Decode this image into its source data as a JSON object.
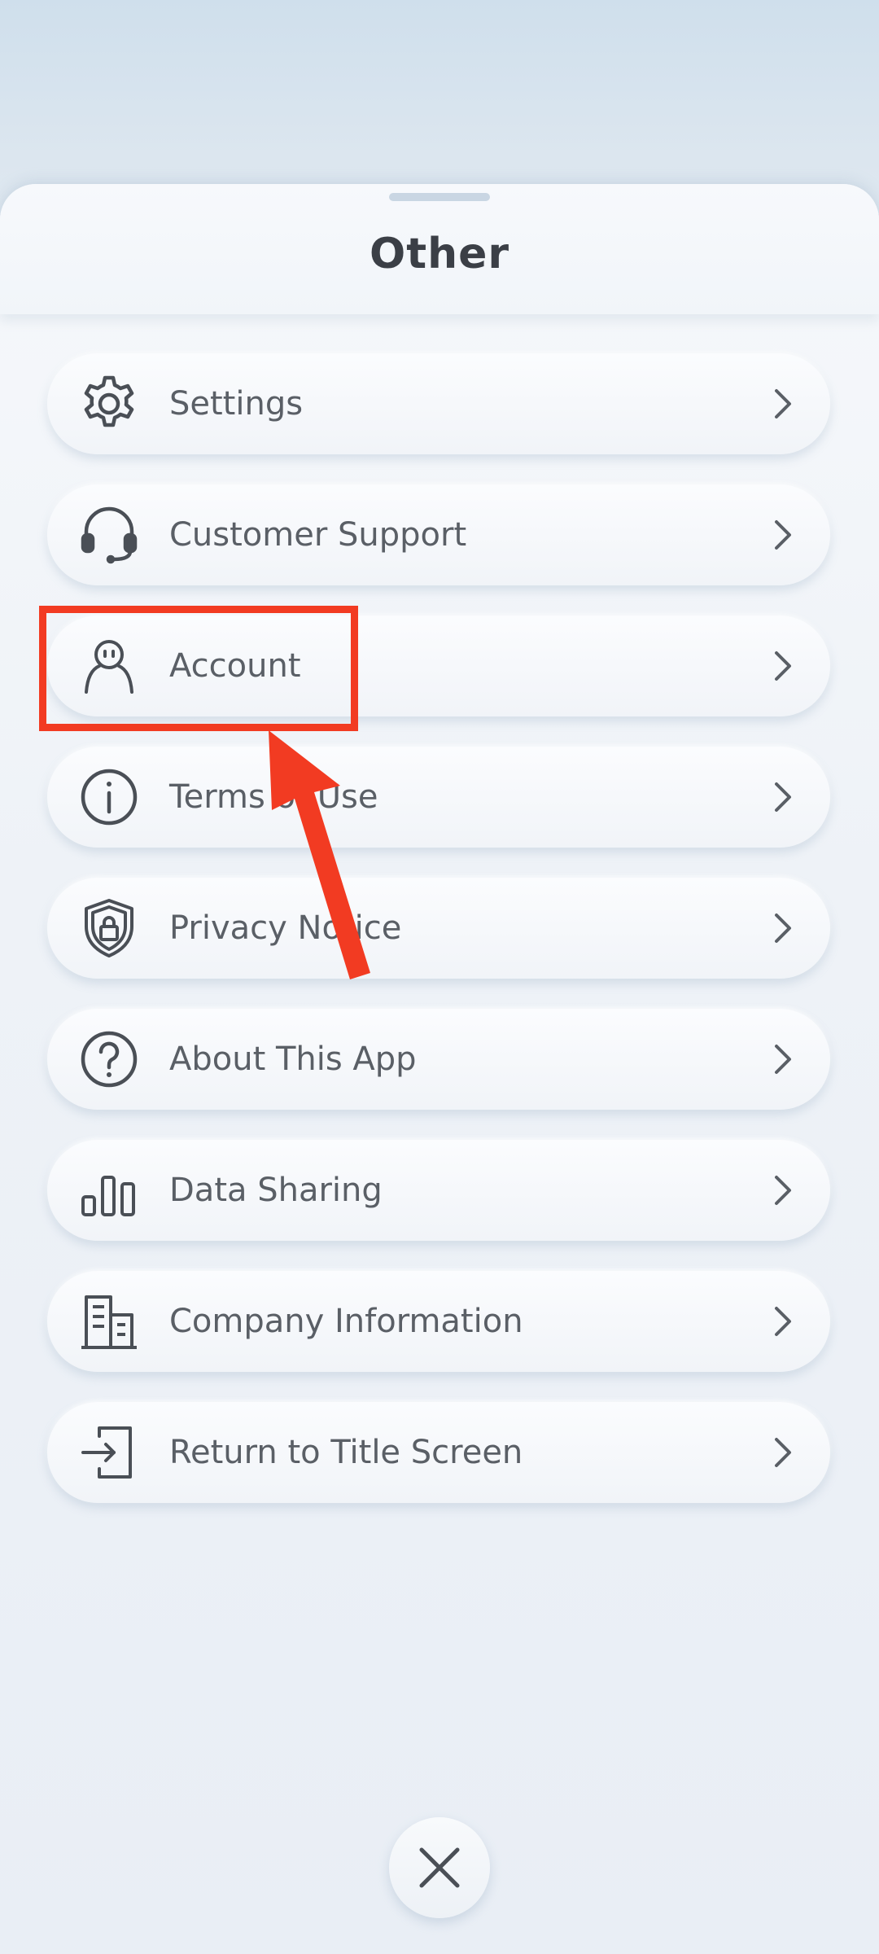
{
  "header": {
    "title": "Other"
  },
  "menu": {
    "items": [
      {
        "label": "Settings",
        "icon": "gear-icon"
      },
      {
        "label": "Customer Support",
        "icon": "headset-icon"
      },
      {
        "label": "Account",
        "icon": "person-icon"
      },
      {
        "label": "Terms of Use",
        "icon": "info-icon"
      },
      {
        "label": "Privacy Notice",
        "icon": "shield-lock-icon"
      },
      {
        "label": "About This App",
        "icon": "question-icon"
      },
      {
        "label": "Data Sharing",
        "icon": "bar-chart-icon"
      },
      {
        "label": "Company Information",
        "icon": "building-icon"
      },
      {
        "label": "Return to Title Screen",
        "icon": "exit-door-icon"
      }
    ]
  },
  "annotation": {
    "highlight_color": "#f23b22"
  },
  "footer": {
    "close_icon": "close-icon"
  }
}
